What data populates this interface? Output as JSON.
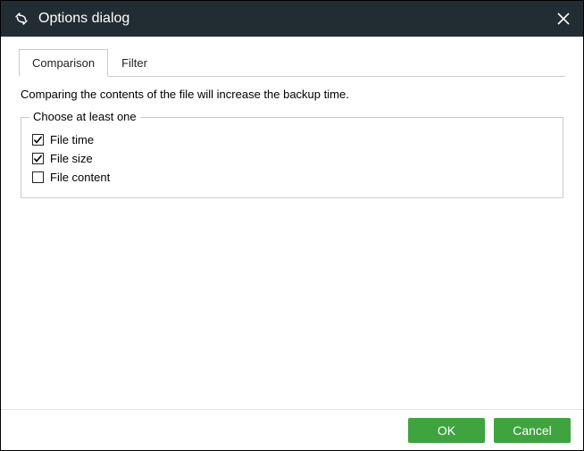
{
  "window": {
    "title": "Options dialog"
  },
  "tabs": {
    "comparison": "Comparison",
    "filter": "Filter",
    "active": "comparison"
  },
  "description": "Comparing the contents of the file will increase the backup time.",
  "fieldset": {
    "legend": "Choose at least one",
    "options": {
      "file_time": {
        "label": "File time",
        "checked": true
      },
      "file_size": {
        "label": "File size",
        "checked": true
      },
      "file_content": {
        "label": "File content",
        "checked": false
      }
    }
  },
  "buttons": {
    "ok": "OK",
    "cancel": "Cancel"
  },
  "colors": {
    "titlebar_bg": "#222c33",
    "button_bg": "#3fa43f",
    "border": "#cccccc"
  }
}
